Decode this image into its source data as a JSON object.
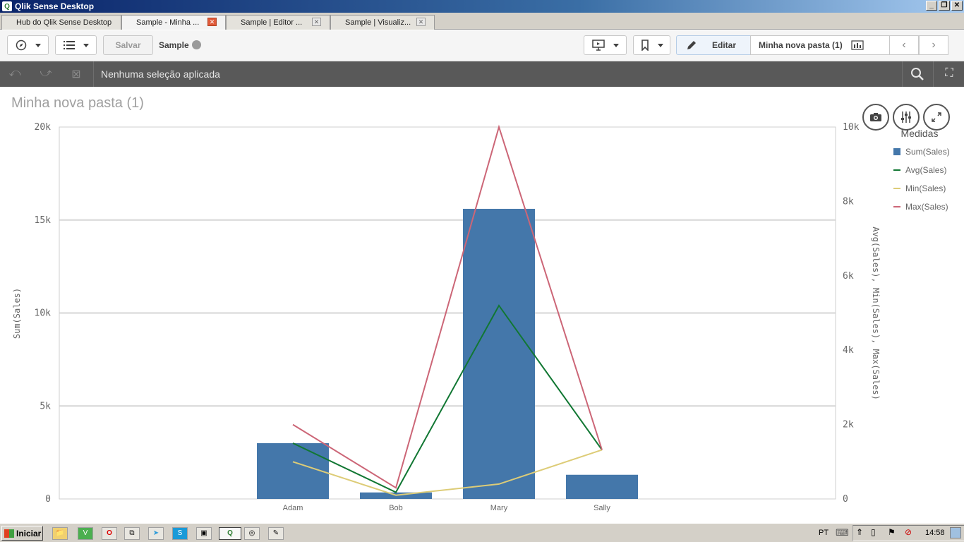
{
  "window": {
    "title": "Qlik Sense Desktop"
  },
  "tabs": [
    {
      "label": "Hub do Qlik Sense Desktop"
    },
    {
      "label": "Sample - Minha ..."
    },
    {
      "label": "Sample | Editor ..."
    },
    {
      "label": "Sample | Visualiz..."
    }
  ],
  "toolbar": {
    "save_label": "Salvar",
    "app_name": "Sample",
    "edit_label": "Editar",
    "sheet_name": "Minha nova pasta (1)"
  },
  "selections": {
    "message": "Nenhuma seleção aplicada"
  },
  "sheet": {
    "title": "Minha nova pasta (1)"
  },
  "chart_data": {
    "type": "bar",
    "categories": [
      "Adam",
      "Bob",
      "Mary",
      "Sally"
    ],
    "left_axis": {
      "label": "Sum(Sales)",
      "ticks": [
        "0",
        "5k",
        "10k",
        "15k",
        "20k"
      ],
      "ylim": [
        0,
        20000
      ]
    },
    "right_axis": {
      "label": "Avg(Sales), Min(Sales), Max(Sales)",
      "ticks": [
        "0",
        "2k",
        "4k",
        "6k",
        "8k",
        "10k"
      ],
      "ylim": [
        0,
        10000
      ]
    },
    "legend": {
      "title": "Medidas",
      "placement": "right"
    },
    "series": [
      {
        "name": "Sum(Sales)",
        "kind": "bar",
        "axis": "left",
        "color": "#4477aa",
        "values": [
          3000,
          350,
          15600,
          1300
        ]
      },
      {
        "name": "Avg(Sales)",
        "kind": "line",
        "axis": "right",
        "color": "#117733",
        "values": [
          1500,
          180,
          5200,
          1320
        ]
      },
      {
        "name": "Min(Sales)",
        "kind": "line",
        "axis": "right",
        "color": "#ddcc77",
        "values": [
          1000,
          100,
          400,
          1320
        ]
      },
      {
        "name": "Max(Sales)",
        "kind": "line",
        "axis": "right",
        "color": "#cc6677",
        "values": [
          2000,
          300,
          10000,
          1320
        ]
      }
    ],
    "grid": true
  },
  "taskbar": {
    "start_label": "Iniciar",
    "language": "PT",
    "clock": "14:58"
  }
}
